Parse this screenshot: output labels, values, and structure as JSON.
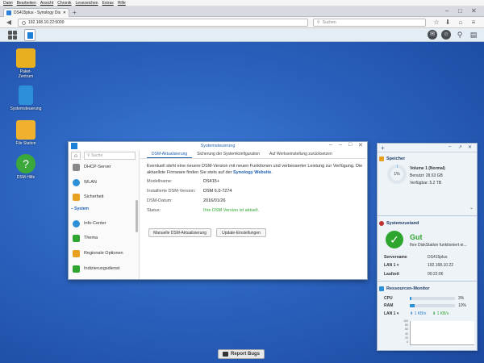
{
  "browser": {
    "menu": [
      "Datei",
      "Bearbeiten",
      "Ansicht",
      "Chronik",
      "Lesezeichen",
      "Extras",
      "Hilfe"
    ],
    "tab_title": "DS415plus - Synology Disk...",
    "new_tab": "+",
    "url": "192.168.10.22:5000",
    "search_placeholder": "Suchen",
    "window_controls": [
      "–",
      "□",
      "✕"
    ]
  },
  "desktop": {
    "icons": [
      {
        "label": "Paket-\nZentrum",
        "icon": "package-center-icon",
        "color": "#e8b020"
      },
      {
        "label": "Systemsteuerung",
        "icon": "control-panel-icon",
        "color": "#2c8fd8"
      },
      {
        "label": "File Station",
        "icon": "folder-icon",
        "color": "#f0b030"
      },
      {
        "label": "DSM Hilfe",
        "icon": "help-icon",
        "color": "#3aa83a"
      }
    ]
  },
  "window": {
    "title": "Systemsteuerung",
    "search_placeholder": "Suche",
    "sidebar": {
      "items_top": [
        {
          "label": "DHCP-Server",
          "color": "#888"
        },
        {
          "label": "WLAN",
          "color": "#2c8fd8"
        },
        {
          "label": "Sicherheit",
          "color": "#e8a020"
        }
      ],
      "section": "System",
      "items_system": [
        {
          "label": "Info-Center",
          "color": "#2c8fd8"
        },
        {
          "label": "Thema",
          "color": "#2ea52e"
        },
        {
          "label": "Regionale Optionen",
          "color": "#e8a020"
        },
        {
          "label": "Indizierungsdienst",
          "color": "#2ea52e"
        }
      ]
    },
    "tabs": [
      "DSM-Aktualisierung",
      "Sicherung der Systemkonfiguration",
      "Auf Werkseinstellung zurücksetzen"
    ],
    "notice_text": "Eventuell steht eine neuere DSM-Version mit neuen Funktionen und verbesserter Leistung zur Verfügung. Die aktuellste Firmware finden Sie stets auf der ",
    "notice_link": "Synology Website",
    "notice_end": ".",
    "fields": [
      {
        "k": "Modellname:",
        "v": "DS415+"
      },
      {
        "k": "Installierte DSM-Version:",
        "v": "DSM 6.0-7274"
      },
      {
        "k": "DSM-Datum:",
        "v": "2016/01/26"
      },
      {
        "k": "Status:",
        "v": "Ihre DSM Version ist aktuell."
      }
    ],
    "btn_manual": "Manuelle DSM-Aktualisierung",
    "btn_update": "Update-Einstellungen"
  },
  "widgets": {
    "storage": {
      "title": "Speicher",
      "percent": "1%",
      "fraction": 0.01,
      "volume": "Volume 1 (Normal)",
      "used_label": "Benutzt:",
      "used": "28.63 GB",
      "free_label": "Verfügbar:",
      "free": "5.2 TB"
    },
    "health": {
      "title": "Systemzustand",
      "status": "Gut",
      "message": "Ihre DiskStation funktioniert ei...",
      "rows": [
        {
          "k": "Servername",
          "v": "DS415plus"
        },
        {
          "k": "LAN 1 ▾",
          "v": "192.168.10.22"
        },
        {
          "k": "Laufzeit",
          "v": "00:22:06"
        }
      ]
    },
    "monitor": {
      "title": "Ressourcen-Monitor",
      "cpu_label": "CPU",
      "cpu": "3%",
      "cpu_fraction": 0.03,
      "ram_label": "RAM",
      "ram": "10%",
      "ram_fraction": 0.1,
      "lan_label": "LAN 1 ▾",
      "up": "1 KB/s",
      "down": "1 KB/s",
      "graph_ticks": [
        "100",
        "80",
        "60",
        "40",
        "20",
        "0"
      ]
    }
  },
  "report_bugs": "Report Bugs",
  "colors": {
    "accent": "#1f5fb0",
    "ok": "#2ea52e",
    "desktop": "#2b63bf"
  }
}
